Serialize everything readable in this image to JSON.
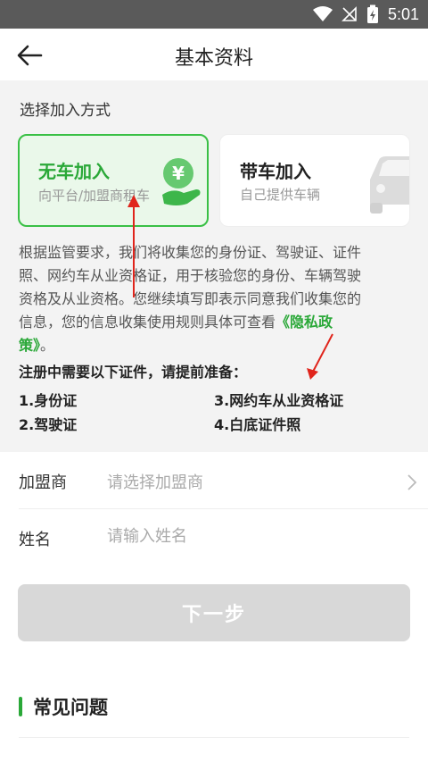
{
  "status_bar": {
    "time": "5:01",
    "icons": [
      "wifi-icon",
      "signal-off-icon",
      "battery-charging-icon"
    ]
  },
  "header": {
    "title": "基本资料",
    "back_icon": "arrow-left-icon"
  },
  "join_section": {
    "title": "选择加入方式",
    "options": [
      {
        "title": "无车加入",
        "subtitle": "向平台/加盟商租车",
        "icon": "yen-hand-icon",
        "selected": true
      },
      {
        "title": "带车加入",
        "subtitle": "自己提供车辆",
        "icon": "car-icon",
        "selected": false
      }
    ]
  },
  "notice": {
    "lines": [
      "根据监管要求，我们将收集您的身份证、驾驶证、证件",
      "照、网约车从业资格证，用于核验您的身份、车辆驾驶",
      "资格及从业资格。您继续填写即表示同意我们收集您的",
      "信息，您的信息收集使用规则具体可查看"
    ],
    "link_part1": "《隐私政",
    "link_part2": "策》",
    "end": "。"
  },
  "requirements": {
    "title": "注册中需要以下证件，请提前准备：",
    "items": [
      "1.身份证",
      "2.驾驶证",
      "3.网约车从业资格证",
      "4.白底证件照"
    ]
  },
  "form": {
    "franchise": {
      "label": "加盟商",
      "placeholder": "请选择加盟商"
    },
    "name": {
      "label": "姓名",
      "placeholder": "请输入姓名"
    }
  },
  "next_button": {
    "label": "下一步",
    "enabled": false
  },
  "faq": {
    "title": "常见问题"
  },
  "colors": {
    "accent": "#2aa838",
    "accent_bg": "#eaf8ea",
    "annotation": "#e0241b"
  }
}
